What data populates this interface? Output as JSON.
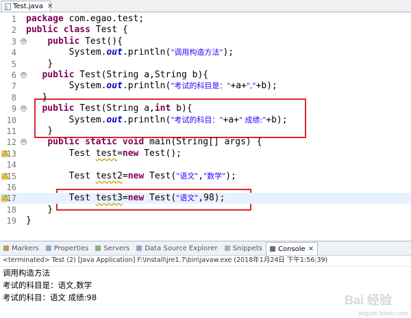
{
  "editor_tab": {
    "filename": "Test.java",
    "close": "✕"
  },
  "code_lines": [
    {
      "n": "1",
      "fold": "",
      "hl": false,
      "mark": "",
      "segs": [
        [
          "kw",
          "package"
        ],
        [
          "t",
          " com.egao.test;"
        ]
      ]
    },
    {
      "n": "2",
      "fold": "",
      "hl": false,
      "mark": "",
      "segs": [
        [
          "kw",
          "public class"
        ],
        [
          "t",
          " Test {"
        ]
      ]
    },
    {
      "n": "3",
      "fold": "⊖",
      "hl": false,
      "mark": "",
      "segs": [
        [
          "t",
          "    "
        ],
        [
          "kw",
          "public"
        ],
        [
          "t",
          " Test(){"
        ]
      ]
    },
    {
      "n": "4",
      "fold": "",
      "hl": false,
      "mark": "",
      "segs": [
        [
          "t",
          "        System."
        ],
        [
          "fld",
          "out"
        ],
        [
          "t",
          ".println("
        ],
        [
          "str",
          "\"调用构造方法\""
        ],
        [
          "t",
          ");"
        ]
      ]
    },
    {
      "n": "5",
      "fold": "",
      "hl": false,
      "mark": "",
      "segs": [
        [
          "t",
          "    }"
        ]
      ]
    },
    {
      "n": "6",
      "fold": "⊖",
      "hl": false,
      "mark": "",
      "segs": [
        [
          "t",
          "   "
        ],
        [
          "kw",
          "public"
        ],
        [
          "t",
          " Test(String a,String b){"
        ]
      ]
    },
    {
      "n": "7",
      "fold": "",
      "hl": false,
      "mark": "",
      "segs": [
        [
          "t",
          "        System."
        ],
        [
          "fld",
          "out"
        ],
        [
          "t",
          ".println("
        ],
        [
          "str",
          "\"考试的科目是：\""
        ],
        [
          "t",
          "+a+"
        ],
        [
          "str",
          "\",\""
        ],
        [
          "t",
          "+b);"
        ]
      ]
    },
    {
      "n": "8",
      "fold": "",
      "hl": false,
      "mark": "",
      "segs": [
        [
          "t",
          "   }"
        ]
      ]
    },
    {
      "n": "9",
      "fold": "⊖",
      "hl": false,
      "mark": "",
      "segs": [
        [
          "t",
          "   "
        ],
        [
          "kw",
          "public"
        ],
        [
          "t",
          " Test(String a,"
        ],
        [
          "kw",
          "int"
        ],
        [
          "t",
          " b){"
        ]
      ]
    },
    {
      "n": "10",
      "fold": "",
      "hl": false,
      "mark": "",
      "segs": [
        [
          "t",
          "        System."
        ],
        [
          "fld",
          "out"
        ],
        [
          "t",
          ".println("
        ],
        [
          "str",
          "\"考试的科目：\""
        ],
        [
          "t",
          "+a+"
        ],
        [
          "str",
          "\" 成绩:\""
        ],
        [
          "t",
          "+b);"
        ]
      ]
    },
    {
      "n": "11",
      "fold": "",
      "hl": false,
      "mark": "",
      "segs": [
        [
          "t",
          "    }"
        ]
      ]
    },
    {
      "n": "12",
      "fold": "⊖",
      "hl": false,
      "mark": "",
      "segs": [
        [
          "t",
          "    "
        ],
        [
          "kw",
          "public static void"
        ],
        [
          "t",
          " main(String[] args) {"
        ]
      ]
    },
    {
      "n": "13",
      "fold": "",
      "hl": false,
      "mark": "warn",
      "segs": [
        [
          "t",
          "        Test "
        ],
        [
          "warn",
          "test"
        ],
        [
          "t",
          "="
        ],
        [
          "kw",
          "new"
        ],
        [
          "t",
          " Test();"
        ]
      ]
    },
    {
      "n": "14",
      "fold": "",
      "hl": false,
      "mark": "",
      "segs": [
        [
          "t",
          ""
        ]
      ]
    },
    {
      "n": "15",
      "fold": "",
      "hl": false,
      "mark": "warn",
      "segs": [
        [
          "t",
          "        Test "
        ],
        [
          "warn",
          "test2"
        ],
        [
          "t",
          "="
        ],
        [
          "kw",
          "new"
        ],
        [
          "t",
          " Test("
        ],
        [
          "str",
          "\"语文\""
        ],
        [
          "t",
          ","
        ],
        [
          "str",
          "\"数学\""
        ],
        [
          "t",
          ");"
        ]
      ]
    },
    {
      "n": "16",
      "fold": "",
      "hl": false,
      "mark": "",
      "segs": [
        [
          "t",
          ""
        ]
      ]
    },
    {
      "n": "17",
      "fold": "",
      "hl": true,
      "mark": "warn",
      "segs": [
        [
          "t",
          "        Test "
        ],
        [
          "warn",
          "test3"
        ],
        [
          "t",
          "="
        ],
        [
          "kw",
          "new"
        ],
        [
          "t",
          " Test("
        ],
        [
          "str",
          "\"语文\""
        ],
        [
          "t",
          ",98);"
        ]
      ]
    },
    {
      "n": "18",
      "fold": "",
      "hl": false,
      "mark": "",
      "segs": [
        [
          "t",
          "    }"
        ]
      ]
    },
    {
      "n": "19",
      "fold": "",
      "hl": false,
      "mark": "",
      "segs": [
        [
          "t",
          "}"
        ]
      ]
    }
  ],
  "panel_tabs": [
    {
      "label": "Markers",
      "icon": "markers-icon",
      "active": false,
      "color": "#b07a2a"
    },
    {
      "label": "Properties",
      "icon": "properties-icon",
      "active": false,
      "color": "#6a8fb8"
    },
    {
      "label": "Servers",
      "icon": "servers-icon",
      "active": false,
      "color": "#6a9b5c"
    },
    {
      "label": "Data Source Explorer",
      "icon": "data-source-icon",
      "active": false,
      "color": "#8c7bb5"
    },
    {
      "label": "Snippets",
      "icon": "snippets-icon",
      "active": false,
      "color": "#9a9a9a"
    },
    {
      "label": "Console",
      "icon": "console-icon",
      "active": true,
      "color": "#3c3c3c"
    }
  ],
  "panel_close": "✕",
  "console": {
    "header": "<terminated> Test (2) [Java Application] F:\\Install\\jre1.7\\bin\\javaw.exe (2018年1月24日 下午1:56:39)",
    "output": [
      "调用构造方法",
      "考试的科目是：语文,数学",
      "考试的科目：语文 成绩:98"
    ]
  },
  "watermark": {
    "site": "jingyan.baidu.com",
    "logo": "Bai 经验"
  },
  "colors": {
    "highlight_box": "#e0242a",
    "keyword": "#7f0055",
    "string": "#2a00ff",
    "field": "#0000c0",
    "current_line": "#e8f2fe"
  }
}
